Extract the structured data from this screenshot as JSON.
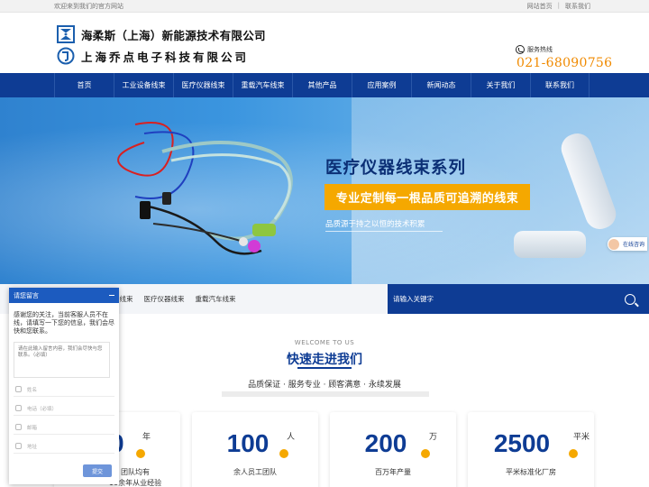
{
  "topbar": {
    "welcome": "欢迎来到我们的官方网站",
    "home_link": "网站首页",
    "separator": "|",
    "contact_link": "联系我们"
  },
  "header": {
    "company_1": "海柔斯（上海）新能源技术有限公司",
    "company_2": "上海乔点电子科技有限公司",
    "hotline_label": "服务热线",
    "phone": "021-68090756",
    "accent_color": "#f08a00"
  },
  "nav": {
    "items": [
      "首页",
      "工业设备线束",
      "医疗仪器线束",
      "重载汽车线束",
      "其他产品",
      "应用案例",
      "新闻动态",
      "关于我们",
      "联系我们"
    ],
    "color": "#0e3c94"
  },
  "banner": {
    "title": "医疗仪器线束系列",
    "ribbon": "专业定制每一根品质可追溯的线束",
    "subtitle": "品质源于持之以恒的技术积累",
    "online_label": "在线咨询"
  },
  "search": {
    "hot_items": [
      "备线束",
      "医疗仪器线束",
      "重载汽车线束"
    ],
    "placeholder": "请输入关键字"
  },
  "about": {
    "welcome": "WELCOME TO US",
    "title": "快速走进我们",
    "subtitle": "品质保证 · 服务专业 · 顾客满意 · 永续发展",
    "stats": [
      {
        "number": "0",
        "unit": "年",
        "label": "团队均有"
      },
      {
        "number": "100",
        "unit": "人",
        "label": "余人员工团队"
      },
      {
        "number": "200",
        "unit": "万",
        "label": "百万年产量"
      },
      {
        "number": "2500",
        "unit": "平米",
        "label": "平米标准化厂房"
      }
    ],
    "stat_extra": "10余年从业经验"
  },
  "chat": {
    "header": "请您留言",
    "intro": "感谢您的关注，当前客服人员不在线，请填写一下您的信息，我们会尽快和您联系。",
    "message_placeholder": "请在此输入留言内容，我们会尽快与您联系。（必填）",
    "fields": [
      "姓名",
      "电话（必填）",
      "邮箱",
      "地址"
    ],
    "submit": "提交",
    "header_color": "#1c5bbf"
  }
}
